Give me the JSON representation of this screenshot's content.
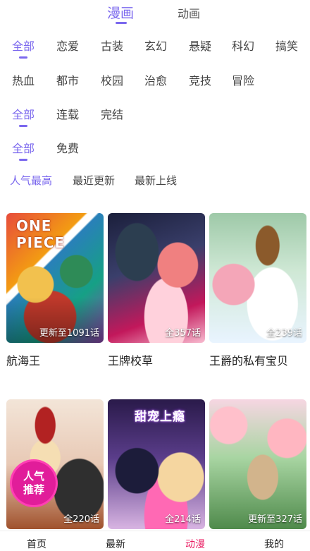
{
  "top_tabs": [
    {
      "label": "漫画",
      "active": true
    },
    {
      "label": "动画",
      "active": false
    }
  ],
  "filters": {
    "genre": [
      "全部",
      "恋爱",
      "古装",
      "玄幻",
      "悬疑",
      "科幻",
      "搞笑",
      "热血",
      "都市",
      "校园",
      "治愈",
      "竞技",
      "冒险"
    ],
    "status": [
      "全部",
      "连载",
      "完结"
    ],
    "price": [
      "全部",
      "免费"
    ]
  },
  "sort": [
    "人气最高",
    "最近更新",
    "最新上线"
  ],
  "comics": [
    {
      "title": "航海王",
      "badge": "更新至1091话",
      "cover_title": "ONE PIECE"
    },
    {
      "title": "王牌校草",
      "badge": "全357话",
      "cover_title": ""
    },
    {
      "title": "王爵的私有宝贝",
      "badge": "全239话",
      "cover_title": ""
    },
    {
      "title": "",
      "badge": "全220话",
      "cover_title": "",
      "promo": "人气推荐"
    },
    {
      "title": "",
      "badge": "全214话",
      "cover_title": "甜宠上瘾"
    },
    {
      "title": "",
      "badge": "更新至327话",
      "cover_title": ""
    }
  ],
  "bottom_nav": [
    {
      "label": "首页",
      "active": false
    },
    {
      "label": "最新",
      "active": false
    },
    {
      "label": "动漫",
      "active": true
    },
    {
      "label": "我的",
      "active": false
    }
  ],
  "colors": {
    "accent": "#7b68ee",
    "nav_active": "#e91e63",
    "promo": "#e11d9a"
  }
}
